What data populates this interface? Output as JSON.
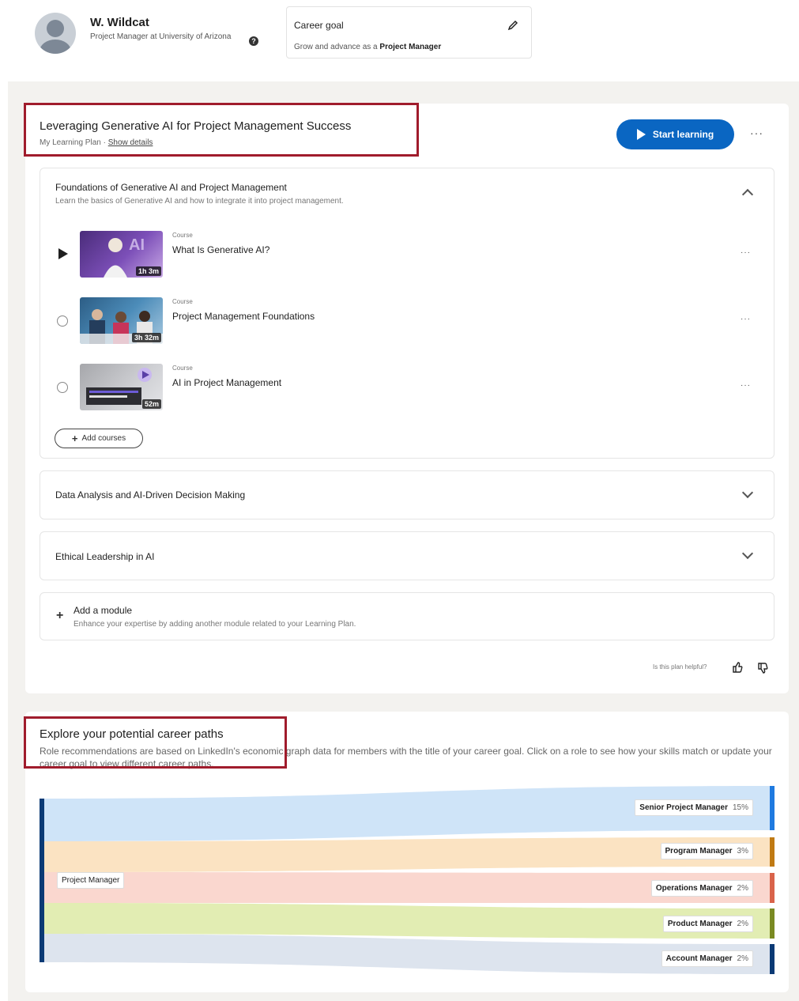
{
  "profile": {
    "name": "W. Wildcat",
    "title": "Project Manager at University of Arizona"
  },
  "career_goal": {
    "label": "Career goal",
    "prefix": "Grow and advance as a",
    "role": "Project Manager"
  },
  "plan": {
    "title": "Leveraging Generative AI for Project Management Success",
    "subtitle": "My Learning Plan ·",
    "show_details": "Show details",
    "start_label": "Start learning",
    "more": "···"
  },
  "modules": [
    {
      "title": "Foundations of Generative AI and Project Management",
      "desc": "Learn the basics of Generative AI and how to integrate it into project management.",
      "courses": [
        {
          "type": "Course",
          "title": "What Is Generative AI?",
          "duration": "1h 3m",
          "thumb_color": "#6b3fa0",
          "status": "play"
        },
        {
          "type": "Course",
          "title": "Project Management Foundations",
          "duration": "3h 32m",
          "thumb_color": "#3a7ca5",
          "status": "unstarted"
        },
        {
          "type": "Course",
          "title": "AI in Project Management",
          "duration": "52m",
          "thumb_color": "#8a8f99",
          "status": "unstarted"
        }
      ],
      "add_courses": "Add courses"
    },
    {
      "title": "Data Analysis and AI-Driven Decision Making"
    },
    {
      "title": "Ethical Leadership in AI"
    }
  ],
  "add_module": {
    "title": "Add a module",
    "desc": "Enhance your expertise by adding another module related to your Learning Plan."
  },
  "feedback": {
    "question": "Is this plan helpful?"
  },
  "career_paths": {
    "title": "Explore your potential career paths",
    "desc": "Role recommendations are based on LinkedIn's economic graph data for members with the title of your career goal. Click on a role to see how your skills match or update your career goal to view different career paths.",
    "source": "Project Manager",
    "source_color": "#0b3a75",
    "targets": [
      {
        "name": "Senior Project Manager",
        "pct": "15%",
        "flow_color": "#cfe4f8",
        "bar_color": "#1f7ae0"
      },
      {
        "name": "Program Manager",
        "pct": "3%",
        "flow_color": "#fbe3c2",
        "bar_color": "#c07a13"
      },
      {
        "name": "Operations Manager",
        "pct": "2%",
        "flow_color": "#fad7cf",
        "bar_color": "#d9634a"
      },
      {
        "name": "Product Manager",
        "pct": "2%",
        "flow_color": "#e2edb3",
        "bar_color": "#7a8a22"
      },
      {
        "name": "Account Manager",
        "pct": "2%",
        "flow_color": "#dde4ee",
        "bar_color": "#0b3a75"
      }
    ]
  }
}
